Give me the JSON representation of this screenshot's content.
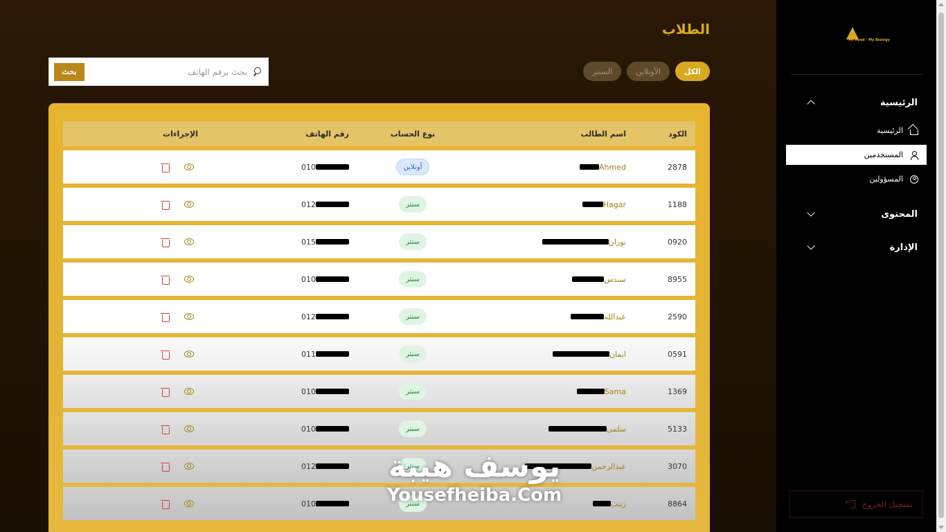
{
  "sidebar": {
    "logo_text": "Mr Ayed · My Biology",
    "groups": [
      {
        "label": "الرئيسية",
        "expanded": true,
        "items": [
          {
            "label": "الرئيسية",
            "icon": "home-icon"
          },
          {
            "label": "المستخدمين",
            "icon": "user-icon",
            "active": true
          },
          {
            "label": "المسؤولين",
            "icon": "user-circle-icon"
          }
        ]
      },
      {
        "label": "المحتوى",
        "expanded": false
      },
      {
        "label": "الإدارة",
        "expanded": false
      }
    ],
    "logout_label": "تسجيل الخروج"
  },
  "page": {
    "title": "الطلاب",
    "search_placeholder": "بحث برقم الهاتف",
    "search_button": "بحث",
    "filters": [
      {
        "label": "الكل",
        "active": true
      },
      {
        "label": "الأونلاين",
        "active": false
      },
      {
        "label": "السنتر",
        "active": false
      }
    ]
  },
  "table": {
    "headers": {
      "code": "الكود",
      "name": "اسم الطالب",
      "type": "نوع الحساب",
      "phone": "رقم الهاتف",
      "actions": "الإجراءات"
    },
    "rows": [
      {
        "code": "2878",
        "name": "Ahmed",
        "type": "أونلاين",
        "type_kind": "online",
        "phone": "010"
      },
      {
        "code": "1188",
        "name": "Hagar",
        "type": "سنتر",
        "type_kind": "center",
        "phone": "012"
      },
      {
        "code": "0920",
        "name": "نوران",
        "type": "سنتر",
        "type_kind": "center",
        "phone": "015"
      },
      {
        "code": "8955",
        "name": "سندس",
        "type": "سنتر",
        "type_kind": "center",
        "phone": "010"
      },
      {
        "code": "2590",
        "name": "عبدالله",
        "type": "سنتر",
        "type_kind": "center",
        "phone": "012"
      },
      {
        "code": "0591",
        "name": "ايمان",
        "type": "سنتر",
        "type_kind": "center",
        "phone": "011"
      },
      {
        "code": "1369",
        "name": "Sama",
        "type": "سنتر",
        "type_kind": "center",
        "phone": "010"
      },
      {
        "code": "5133",
        "name": "سلمى",
        "type": "سنتر",
        "type_kind": "center",
        "phone": "010"
      },
      {
        "code": "3070",
        "name": "عبدالرحمن",
        "type": "سنتر",
        "type_kind": "center",
        "phone": "012"
      },
      {
        "code": "8864",
        "name": "زينب",
        "type": "سنتر",
        "type_kind": "center",
        "phone": "010"
      }
    ]
  },
  "watermark": {
    "arabic": "يوسف هيبة",
    "english": "Yousefheiba.Com"
  },
  "colors": {
    "accent": "#d8a920",
    "table_bg": "#e7b42f",
    "danger": "#d93a3a"
  }
}
